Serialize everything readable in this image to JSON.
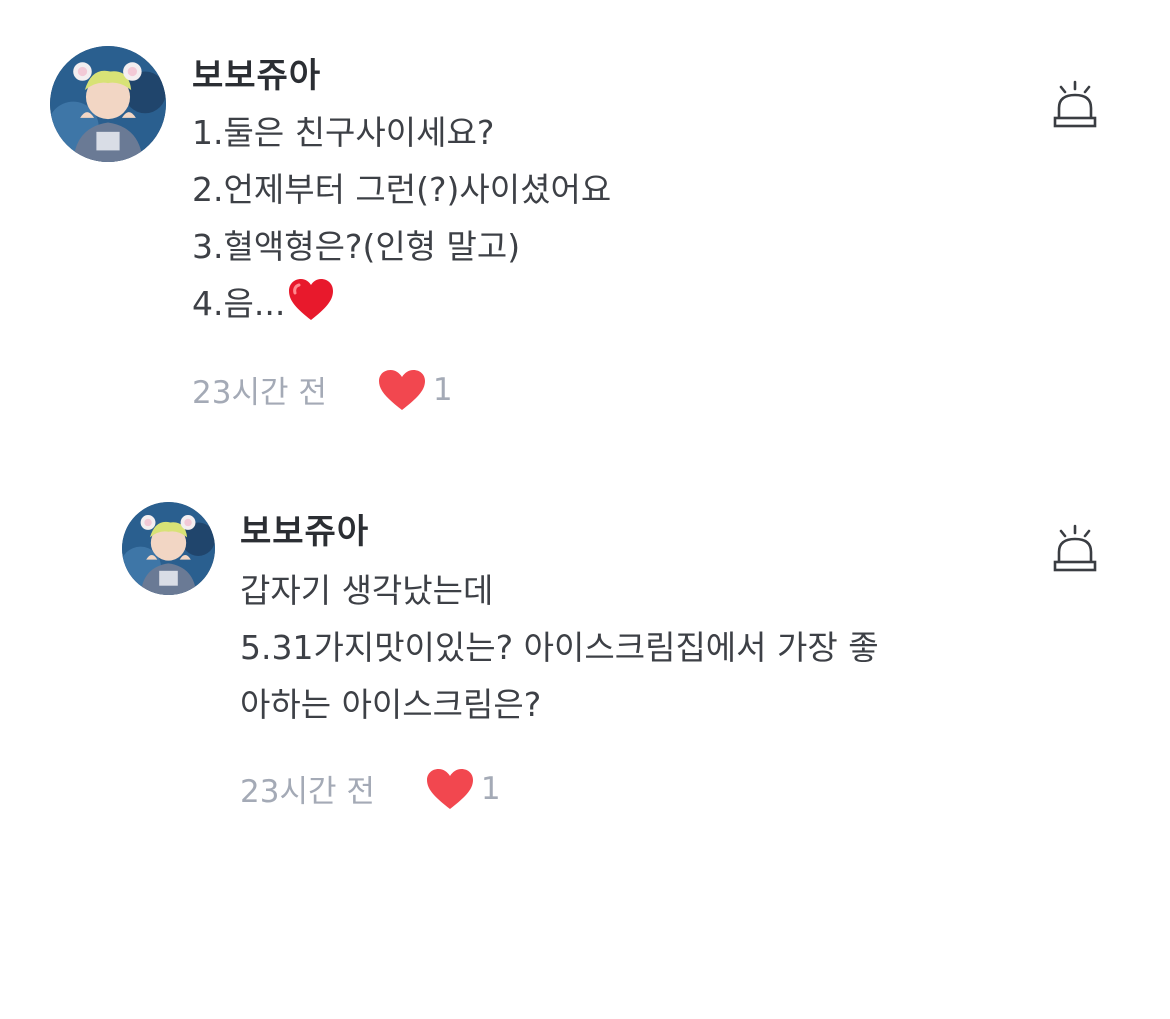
{
  "comments": [
    {
      "author": "보보쥬아",
      "lines": [
        "1.둘은 친구사이세요?",
        "2.언제부터 그런(?)사이셨어요",
        "3.혈액형은?(인형 말고)",
        "4.음..."
      ],
      "time": "23시간 전",
      "likes": "1",
      "report_icon": "siren-icon",
      "like_icon": "heart-icon"
    },
    {
      "author": "보보쥬아",
      "lines": [
        "갑자기 생각났는데",
        "5.31가지맛이있는? 아이스크림집에서 가장 좋",
        "아하는 아이스크림은?"
      ],
      "time": "23시간 전",
      "likes": "1",
      "report_icon": "siren-icon",
      "like_icon": "heart-icon"
    }
  ],
  "colors": {
    "heart": "#f2474f",
    "meta_text": "#a4aab6",
    "author_text": "#2b2e33",
    "body_text": "#3d4046",
    "icon_stroke": "#3a3d42"
  }
}
